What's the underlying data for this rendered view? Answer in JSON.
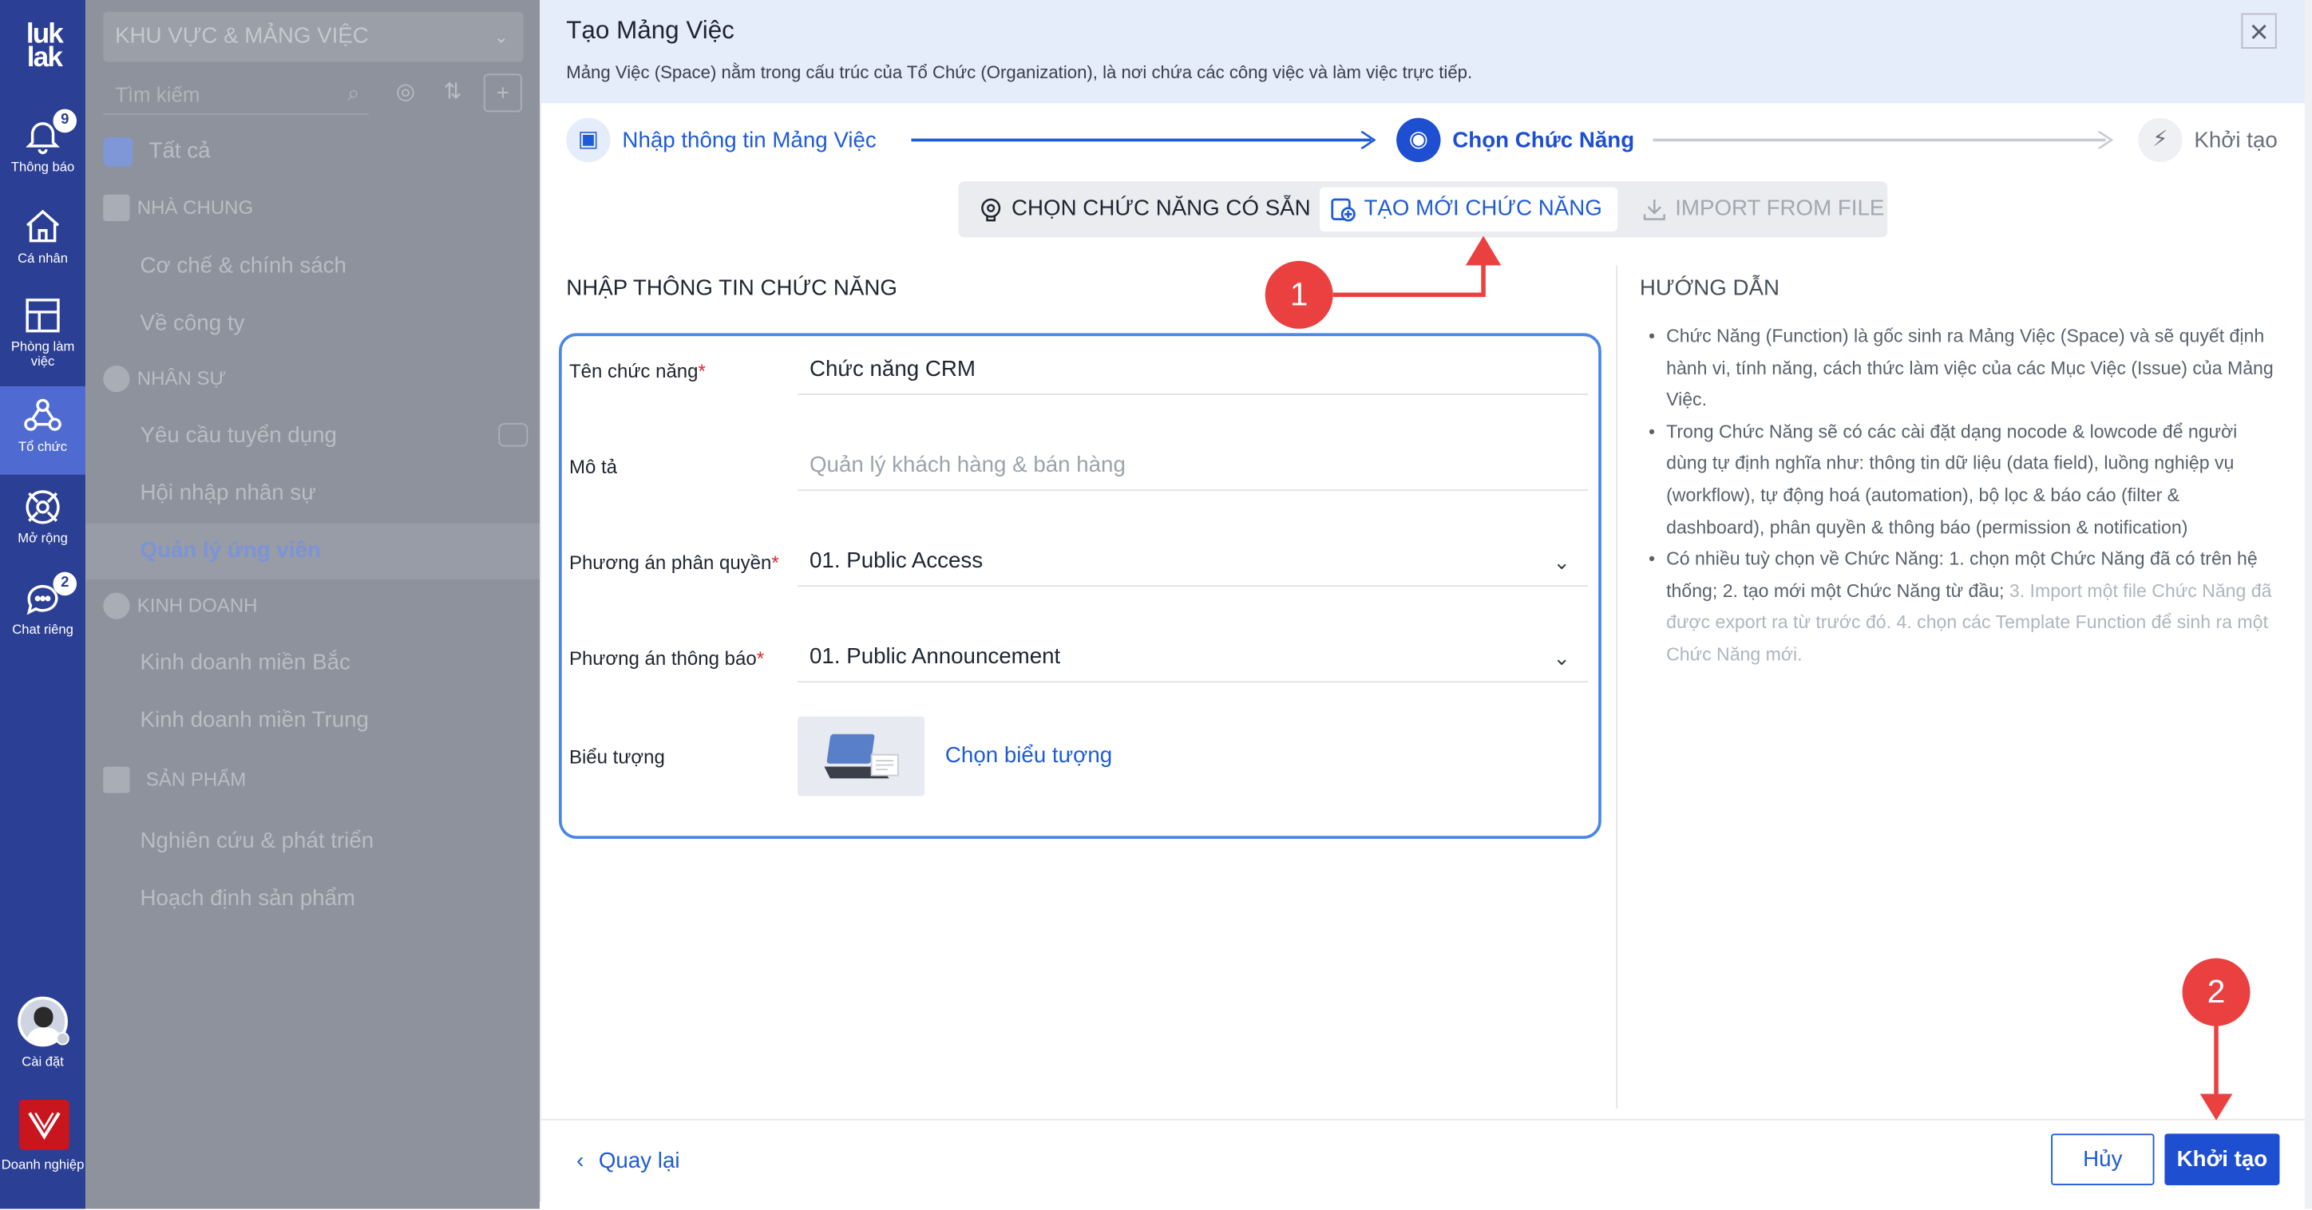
{
  "rail": {
    "logo_line1": "luk",
    "logo_line2": "lak",
    "items": [
      {
        "label": "Thông báo",
        "icon": "bell-icon",
        "badge": "9"
      },
      {
        "label": "Cá nhân",
        "icon": "home-icon"
      },
      {
        "label": "Phòng làm việc",
        "icon": "workspace-icon"
      },
      {
        "label": "Tổ chức",
        "icon": "organization-icon",
        "active": true
      },
      {
        "label": "Mở rộng",
        "icon": "extension-icon"
      },
      {
        "label": "Chat riêng",
        "icon": "chat-icon",
        "badge": "2"
      }
    ],
    "settings_label": "Cài đặt",
    "business_label": "Doanh nghiệp"
  },
  "panel": {
    "space_selector": "KHU VỰC & MẢNG VIỆC",
    "search_placeholder": "Tìm kiếm",
    "all_label": "Tất cả",
    "groups": [
      {
        "title": "NHÀ CHUNG",
        "items": [
          "Cơ chế & chính sách",
          "Về công ty"
        ]
      },
      {
        "title": "NHÂN SỰ",
        "items": [
          "Yêu cầu tuyển dụng",
          "Hội nhập nhân sự",
          "Quản lý ứng viên"
        ]
      },
      {
        "title": "KINH DOANH",
        "items": [
          "Kinh doanh miền Bắc",
          "Kinh doanh miền Trung"
        ]
      },
      {
        "title": "SẢN PHẨM",
        "items": [
          "Nghiên cứu & phát triển",
          "Hoạch định sản phẩm"
        ]
      }
    ],
    "selected_item": "Quản lý ứng viên"
  },
  "dialog": {
    "title": "Tạo Mảng Việc",
    "subtitle": "Mảng Việc (Space) nằm trong cấu trúc của Tổ Chức (Organization), là nơi chứa các công việc và làm việc trực tiếp.",
    "steps": [
      "Nhập thông tin Mảng Việc",
      "Chọn Chức Năng",
      "Khởi tạo"
    ],
    "tabs": [
      "CHỌN CHỨC NĂNG CÓ SẴN",
      "TẠO MỚI CHỨC NĂNG",
      "IMPORT FROM FILE"
    ],
    "section_title": "NHẬP THÔNG TIN CHỨC NĂNG",
    "fields": {
      "name_label": "Tên chức năng",
      "name_value": "Chức năng CRM",
      "desc_label": "Mô tả",
      "desc_placeholder": "Quản lý khách hàng & bán hàng",
      "permission_label": "Phương án phân quyền",
      "permission_value": "01. Public Access",
      "notify_label": "Phương án thông báo",
      "notify_value": "01. Public Announcement",
      "icon_label": "Biểu tượng",
      "choose_icon": "Chọn biểu tượng"
    },
    "guide_title": "HƯỚNG DẪN",
    "guide": {
      "p1": "Chức Năng (Function) là gốc sinh ra Mảng Việc (Space) và sẽ quyết định hành vi, tính năng, cách thức làm việc của các Mục Việc (Issue) của Mảng Việc.",
      "p2": "Trong Chức Năng sẽ có các cài đặt dạng nocode & lowcode để người dùng tự định nghĩa như: thông tin dữ liệu (data field), luồng nghiệp vụ (workflow), tự động hoá (automation), bộ lọc & báo cáo (filter & dashboard), phân quyền & thông báo (permission & notification)",
      "p3_main": "Có nhiều tuỳ chọn về Chức Năng: 1. chọn một Chức Năng đã có trên hệ thống; 2. tạo mới một Chức Năng từ đầu;",
      "p3_muted": " 3. Import một file Chức Năng đã được export ra từ trước đó. 4. chọn các Template Function để sinh ra một Chức Năng mới."
    },
    "back_label": "Quay lại",
    "cancel_label": "Hủy",
    "create_label": "Khởi tạo"
  },
  "annotations": {
    "callout1": "1",
    "callout2": "2",
    "color": "#ea4040"
  }
}
